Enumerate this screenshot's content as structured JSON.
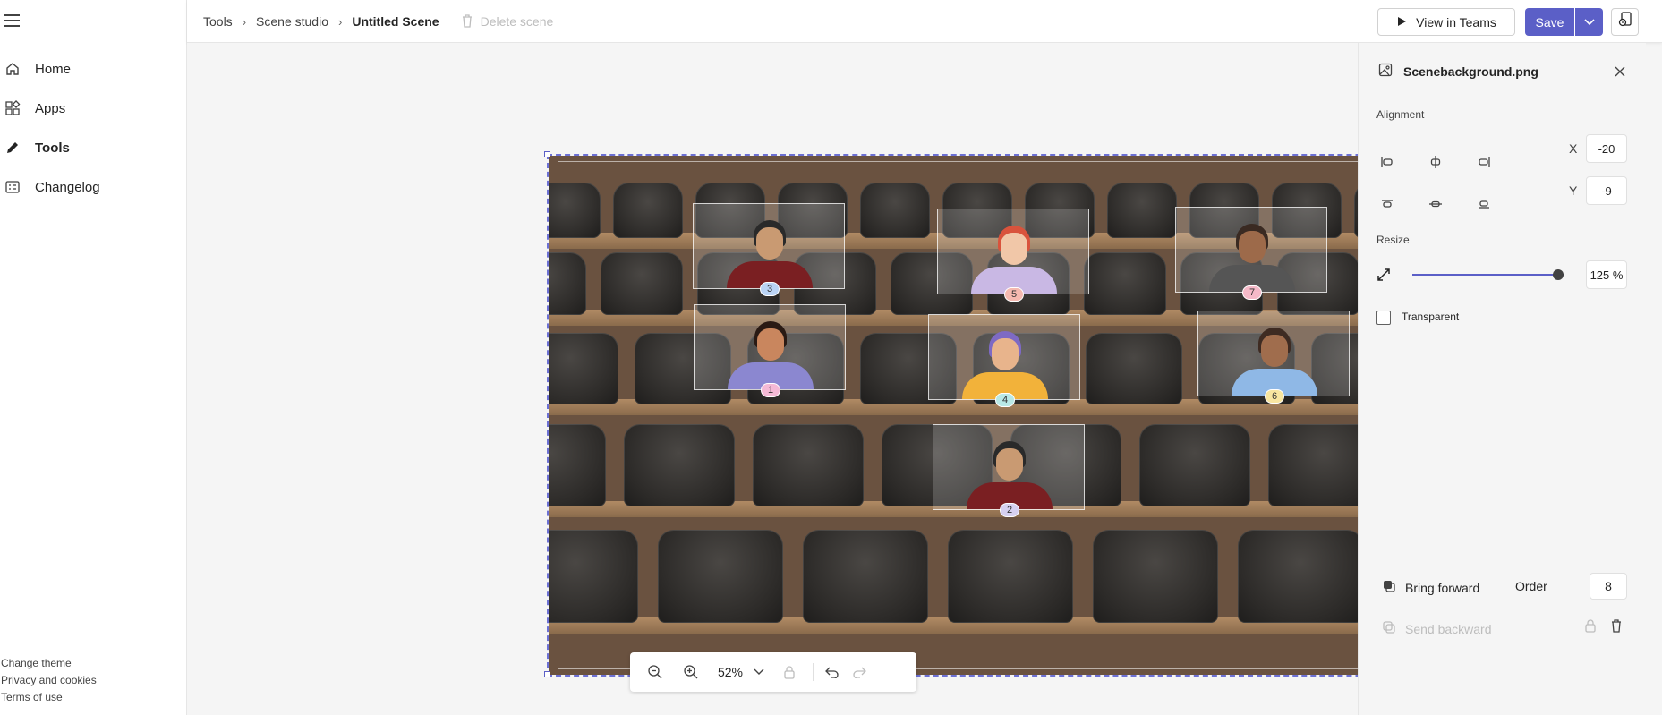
{
  "nav": {
    "items": [
      {
        "label": "Home",
        "icon": "home-icon"
      },
      {
        "label": "Apps",
        "icon": "apps-icon"
      },
      {
        "label": "Tools",
        "icon": "pencil-icon",
        "active": true
      },
      {
        "label": "Changelog",
        "icon": "changelog-icon"
      }
    ],
    "footer": [
      "Change theme",
      "Privacy and cookies",
      "Terms of use"
    ]
  },
  "breadcrumb": {
    "items": [
      "Tools",
      "Scene studio"
    ],
    "current": "Untitled Scene",
    "separator": "›",
    "delete_label": "Delete scene"
  },
  "toolbar": {
    "view_label": "View in Teams",
    "save_label": "Save"
  },
  "scene": {
    "participants": [
      "3",
      "5",
      "7",
      "1",
      "4",
      "6",
      "2"
    ]
  },
  "zoom": {
    "level": "52%"
  },
  "panel": {
    "title": "Scenebackground.png",
    "alignment_label": "Alignment",
    "x_label": "X",
    "x_value": "-20",
    "y_label": "Y",
    "y_value": "-9",
    "resize_label": "Resize",
    "resize_value": "125 %",
    "resize_fraction": 0.96,
    "transparent_label": "Transparent",
    "bring_forward_label": "Bring forward",
    "order_label": "Order",
    "order_value": "8",
    "send_backward_label": "Send backward"
  },
  "colors": {
    "accent": "#5b5fc7",
    "badge_colors": [
      "#b9d3f5",
      "#f5b9b0",
      "#f5b9c8",
      "#f5b9d6",
      "#b9e9e6",
      "#f8e6a0",
      "#d6d0f0"
    ]
  }
}
